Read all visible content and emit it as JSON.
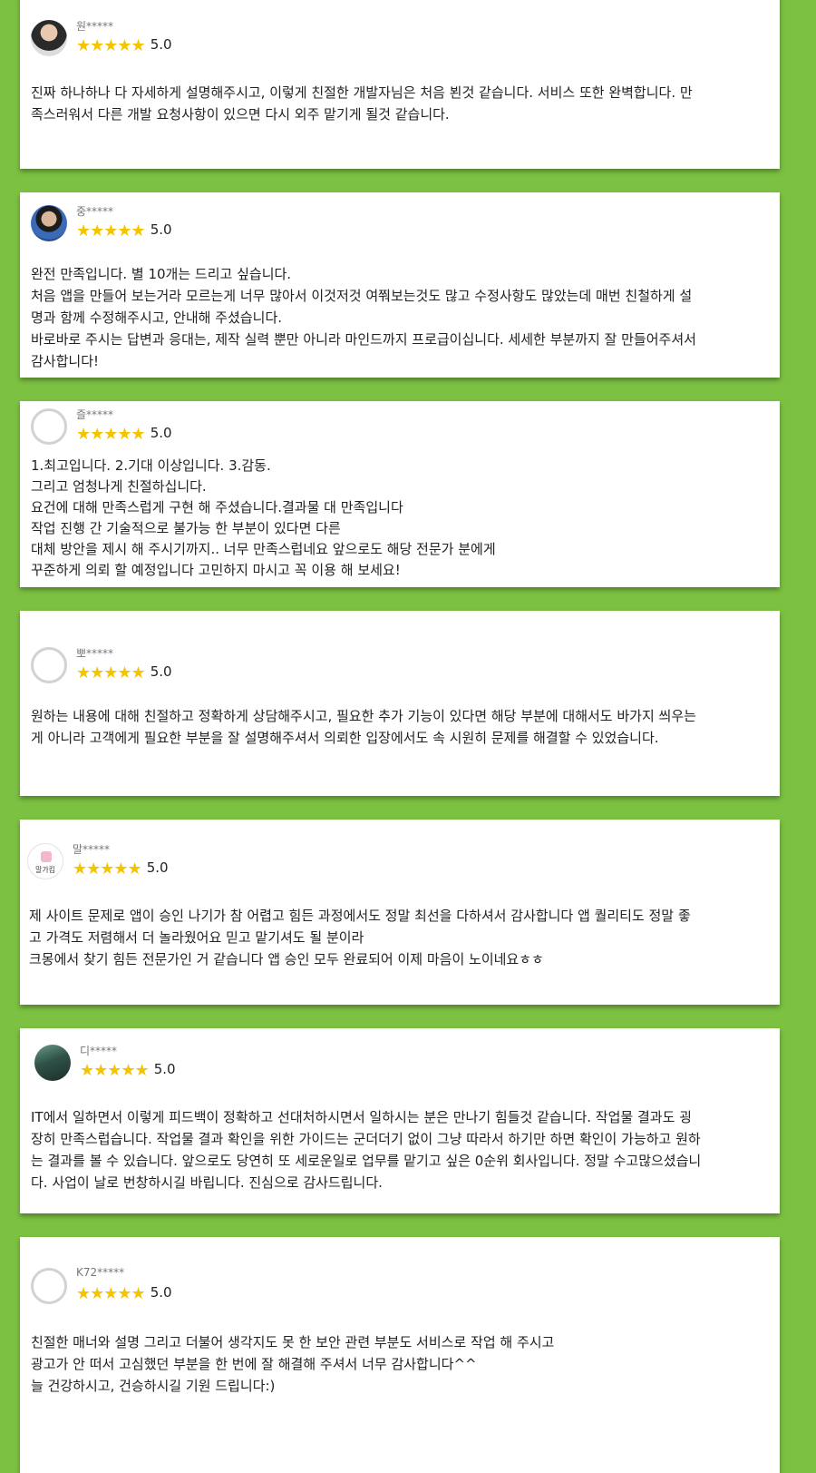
{
  "stars_glyph": "★★★★★",
  "reviews": [
    {
      "name": "원*****",
      "avatar": "user-photo",
      "score": "5.0",
      "lines": [
        "진짜 하나하나 다 자세하게 설명해주시고, 이렇게 친절한 개발자님은 처음 뵌것 같습니다. 서비스 또한 완벽합니다. 만",
        "족스러워서 다른 개발 요청사항이 있으면 다시 외주 맡기게 될것 같습니다."
      ]
    },
    {
      "name": "중*****",
      "avatar": "user-photo",
      "score": "5.0",
      "lines": [
        "완전 만족입니다. 별 10개는 드리고 싶습니다.",
        "처음 앱을 만들어 보는거라 모르는게 너무 많아서 이것저것 여쭤보는것도 많고 수정사항도 많았는데 매번 친철하게 설",
        "명과 함께  수정해주시고, 안내해 주셨습니다.",
        "바로바로 주시는 답변과 응대는, 제작 실력 뿐만 아니라  마인드까지 프로급이십니다. 세세한 부분까지 잘 만들어주셔서",
        "감사합니다!"
      ]
    },
    {
      "name": "즐*****",
      "avatar": "default-avatar",
      "score": "5.0",
      "lines": [
        "1.최고입니다. 2.기대 이상입니다. 3.감동.",
        "그리고  엄청나게 친절하십니다.",
        "요건에 대해 만족스럽게 구현 해 주셨습니다.결과물 대 만족입니다",
        "작업 진행 간 기술적으로 불가능 한 부분이 있다면 다른",
        "대체 방안을 제시 해 주시기까지.. 너무 만족스럽네요 앞으로도 해당 전문가 분에게",
        "꾸준하게 의뢰 할 예정입니다 고민하지 마시고 꼭 이용 해 보세요!"
      ]
    },
    {
      "name": "뽀*****",
      "avatar": "default-avatar",
      "score": "5.0",
      "lines": [
        "원하는 내용에 대해 친절하고 정확하게 상담해주시고, 필요한 추가 기능이 있다면 해당 부분에 대해서도 바가지 씌우는",
        "게 아니라 고객에게 필요한 부분을 잘 설명해주셔서 의뢰한 입장에서도 속 시원히 문제를 해결할 수 있었습니다."
      ]
    },
    {
      "name": "말*****",
      "avatar": "logo-avatar",
      "avatar_text": "말가킴",
      "score": "5.0",
      "lines": [
        "제 사이트 문제로 앱이 승인 나기가 참 어렵고  힘든 과정에서도 정말 최선을 다하셔서 감사합니다 앱 퀄리티도 정말 좋",
        "고 가격도 저렴해서 더 놀라웠어요 믿고 맡기셔도 될 분이라",
        "크몽에서 찾기 힘든 전문가인 거 같습니다 앱 승인 모두 완료되어 이제 마음이 노이네요ㅎㅎ"
      ]
    },
    {
      "name": "디*****",
      "avatar": "user-photo",
      "score": "5.0",
      "lines": [
        "IT에서  일하면서 이렇게 피드백이 정확하고 선대처하시면서 일하시는 분은 만나기 힘들것 같습니다. 작업물 결과도 굉",
        "장히 만족스럽습니다. 작업물 결과 확인을 위한 가이드는 군더더기 없이 그냥 따라서 하기만 하면 확인이 가능하고 원하",
        "는 결과를 볼 수 있습니다. 앞으로도 당연히 또 세로운일로 업무를 맡기고 싶은 0순위 회사입니다. 정말 수고많으셨습니",
        "다. 사업이 날로 번창하시길 바립니다. 진심으로 감사드립니다."
      ]
    },
    {
      "name": "K72*****",
      "avatar": "default-avatar",
      "score": "5.0",
      "lines": [
        "친절한 매너와 설명 그리고 더불어 생각지도 못 한 보안 관련 부분도 서비스로 작업 해 주시고",
        "광고가 안 떠서 고심했던 부분을 한 번에 잘 해결해 주셔서 너무 감사합니다^^",
        "늘 건강하시고, 건승하시길 기원 드립니다:)"
      ]
    }
  ]
}
